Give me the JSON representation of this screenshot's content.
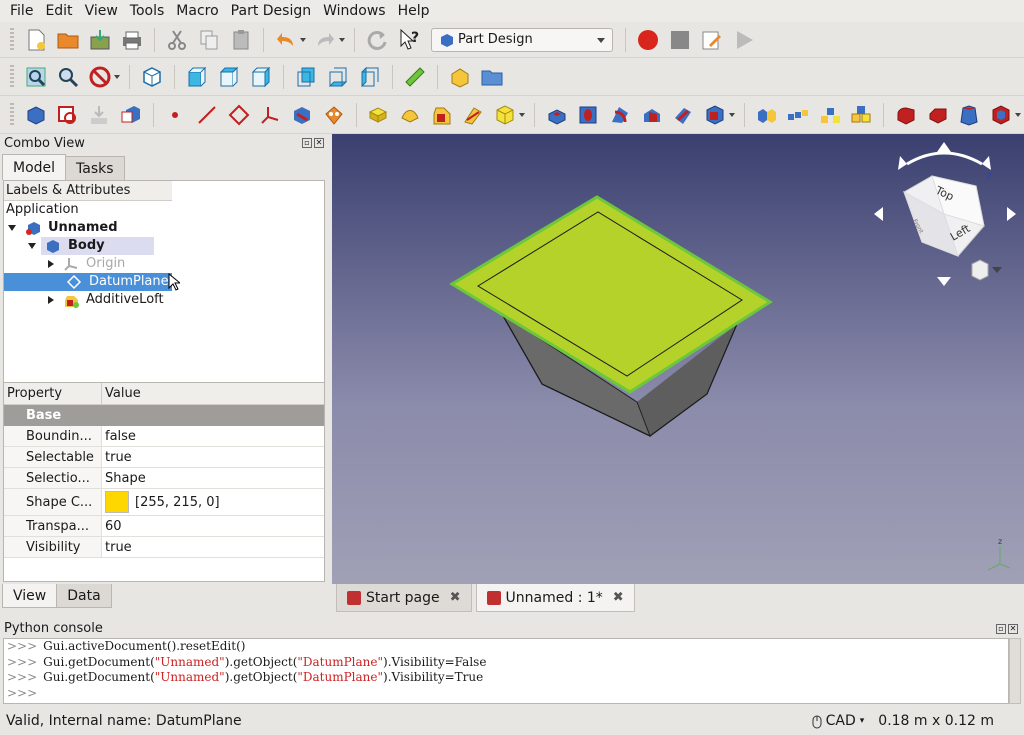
{
  "menu": [
    "File",
    "Edit",
    "View",
    "Tools",
    "Macro",
    "Part Design",
    "Windows",
    "Help"
  ],
  "toolbar": {
    "workbench": "Part Design"
  },
  "combo": {
    "title": "Combo View",
    "tabs": [
      "Model",
      "Tasks"
    ],
    "tree_header": "Labels & Attributes",
    "tree": {
      "application": "Application",
      "document": "Unnamed",
      "body": "Body",
      "origin": "Origin",
      "datum_plane": "DatumPlane",
      "additive_loft": "AdditiveLoft"
    },
    "props": {
      "header_property": "Property",
      "header_value": "Value",
      "group": "Base",
      "rows": [
        {
          "name": "Boundin...",
          "value": "false"
        },
        {
          "name": "Selectable",
          "value": "true"
        },
        {
          "name": "Selectio...",
          "value": "Shape"
        },
        {
          "name": "Shape C...",
          "value": "[255, 215, 0]"
        },
        {
          "name": "Transpa...",
          "value": "60"
        },
        {
          "name": "Visibility",
          "value": "true"
        }
      ]
    },
    "bottom_tabs": [
      "View",
      "Data"
    ]
  },
  "colors": {
    "shape_color": "#ffd700",
    "plane_fill": "#b4d22a",
    "plane_edge": "#6cc83a"
  },
  "navcube": {
    "top_label": "Top",
    "left_label": "Left",
    "front_label": "Front"
  },
  "doc_tabs": [
    "Start page",
    "Unnamed : 1*"
  ],
  "python": {
    "title": "Python console",
    "lines": [
      [
        "Gui.activeDocument().resetEdit()"
      ],
      [
        "Gui.getDocument(",
        "\"Unnamed\"",
        ").getObject(",
        "\"DatumPlane\"",
        ").Visibility=False"
      ],
      [
        "Gui.getDocument(",
        "\"Unnamed\"",
        ").getObject(",
        "\"DatumPlane\"",
        ").Visibility=True"
      ]
    ],
    "prompt": ">>>"
  },
  "status": {
    "left": "Valid, Internal name: DatumPlane",
    "nav_style": "CAD",
    "dimensions": "0.18 m x 0.12 m"
  }
}
